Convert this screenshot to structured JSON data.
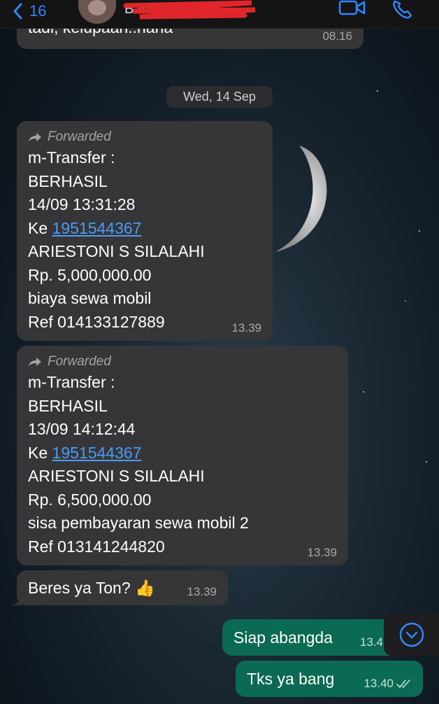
{
  "header": {
    "back_count": "16",
    "contact_name": "Bang"
  },
  "date_separator": "Wed, 14 Sep",
  "messages": [
    {
      "text": "tadi, kelupaan..haha",
      "time": "08.16"
    },
    {
      "forwarded_label": "Forwarded",
      "lines": [
        "m-Transfer :",
        "BERHASIL",
        "14/09 13:31:28"
      ],
      "ke_label": "Ke",
      "account": "1951544367",
      "lines2": [
        "ARIESTONI S SILALAHI",
        "Rp. 5,000,000.00",
        "biaya sewa mobil",
        "Ref 014133127889"
      ],
      "time": "13.39"
    },
    {
      "forwarded_label": "Forwarded",
      "lines": [
        "m-Transfer :",
        "BERHASIL",
        "13/09 14:12:44"
      ],
      "ke_label": "Ke",
      "account": "1951544367",
      "lines2": [
        "ARIESTONI S SILALAHI",
        "Rp. 6,500,000.00",
        "sisa pembayaran sewa mobil 2",
        "Ref 013141244820"
      ],
      "time": "13.39"
    },
    {
      "text": "Beres ya Ton?",
      "emoji": "👍",
      "time": "13.39"
    },
    {
      "text": "Siap abangda",
      "time": "13.4"
    },
    {
      "text": "Tks ya bang",
      "time": "13.40"
    }
  ],
  "colors": {
    "incoming": "#363638",
    "outgoing": "#0b6a53",
    "link": "#4a9cf5",
    "accent": "#2f88ff"
  },
  "icons": [
    "chevron-left-icon",
    "video-call-icon",
    "phone-icon",
    "forward-arrow-icon",
    "scroll-down-icon",
    "read-checks-icon"
  ]
}
